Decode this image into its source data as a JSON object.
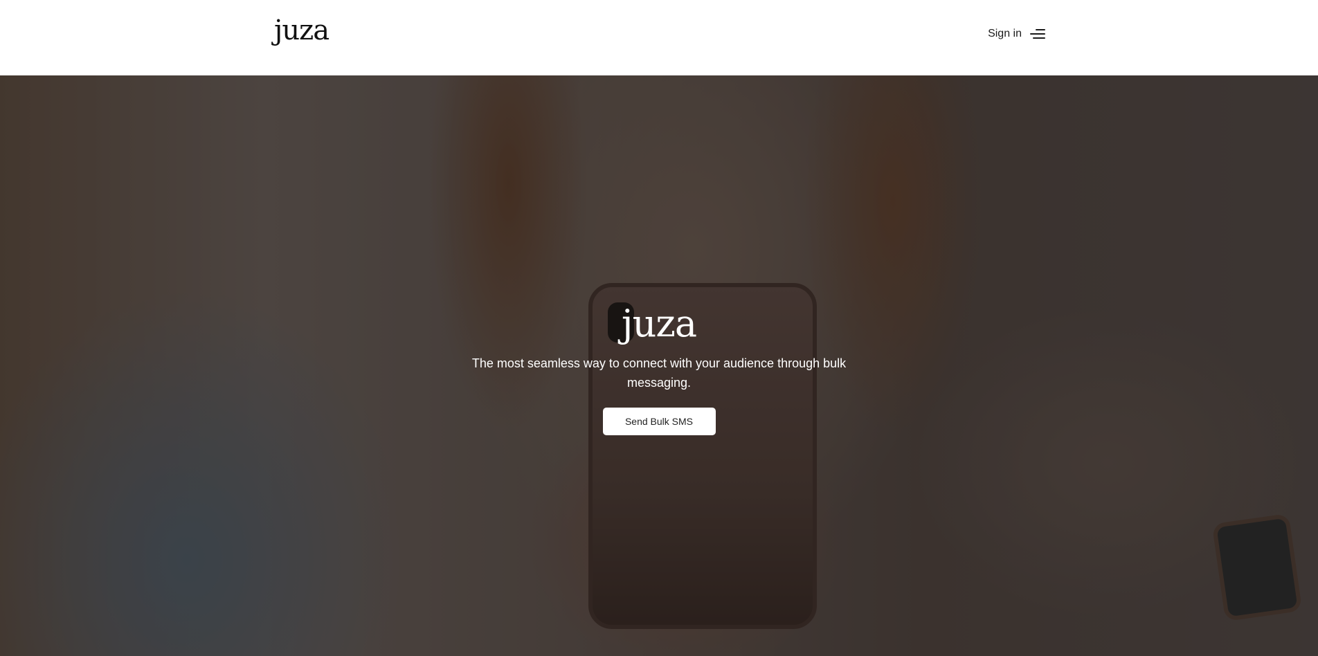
{
  "header": {
    "logo_text": "juza",
    "signin_label": "Sign in",
    "menu_icon": "hamburger-menu-icon"
  },
  "hero": {
    "logo_text": "juza",
    "tagline": "The most seamless way to connect with your audience through bulk messaging.",
    "cta_label": "Send Bulk SMS"
  }
}
